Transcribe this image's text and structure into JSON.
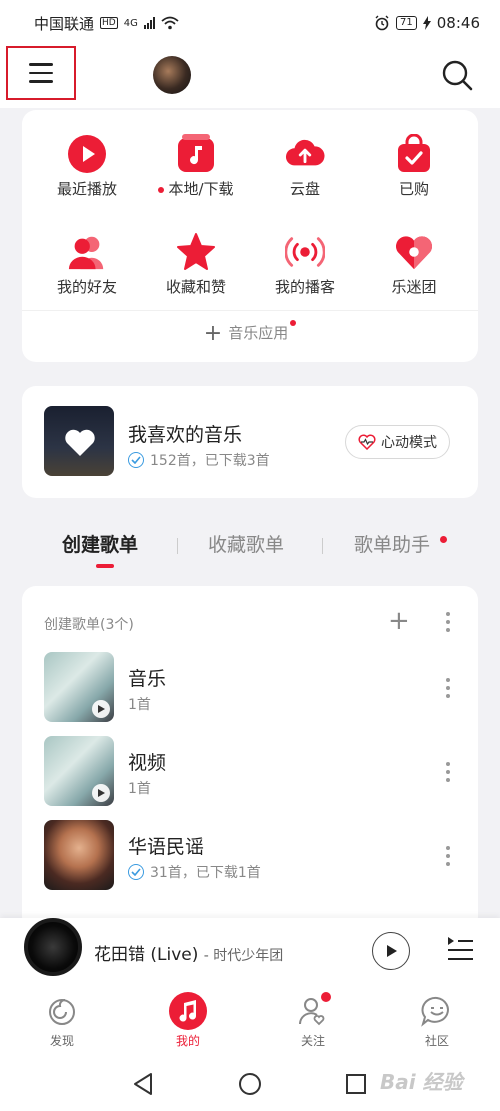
{
  "status": {
    "carrier": "中国联通",
    "net": "4G",
    "battery": "71",
    "time": "08:46"
  },
  "header": {
    "menu_icon": "hamburger-icon",
    "search_icon": "search-icon"
  },
  "quick": [
    {
      "label": "最近播放",
      "icon": "play-circle-icon",
      "dot": false
    },
    {
      "label": "本地/下载",
      "icon": "music-note-icon",
      "dot": true
    },
    {
      "label": "云盘",
      "icon": "cloud-upload-icon",
      "dot": false
    },
    {
      "label": "已购",
      "icon": "bag-check-icon",
      "dot": false
    },
    {
      "label": "我的好友",
      "icon": "friends-icon",
      "dot": false
    },
    {
      "label": "收藏和赞",
      "icon": "star-icon",
      "dot": false
    },
    {
      "label": "我的播客",
      "icon": "broadcast-icon",
      "dot": false
    },
    {
      "label": "乐迷团",
      "icon": "heart-badge-icon",
      "dot": false
    }
  ],
  "apps": {
    "label": "音乐应用"
  },
  "favorite": {
    "title": "我喜欢的音乐",
    "subtitle": "152首，已下载3首",
    "mode_label": "心动模式"
  },
  "tabs": [
    {
      "label": "创建歌单"
    },
    {
      "label": "收藏歌单"
    },
    {
      "label": "歌单助手"
    }
  ],
  "playlists": {
    "header": "创建歌单(3个)",
    "items": [
      {
        "title": "音乐",
        "count": "1首"
      },
      {
        "title": "视频",
        "count": "1首"
      },
      {
        "title": "华语民谣",
        "count": "31首，已下载1首"
      }
    ]
  },
  "player": {
    "title": "花田错 (Live)",
    "artist": "- 时代少年团"
  },
  "nav": [
    {
      "label": "发现"
    },
    {
      "label": "我的"
    },
    {
      "label": "关注"
    },
    {
      "label": "社区"
    }
  ],
  "watermark": "Bai 经验",
  "colors": {
    "accent": "#ec1d36",
    "highlight_box": "#d71b2b",
    "check_blue": "#3b9be0"
  }
}
